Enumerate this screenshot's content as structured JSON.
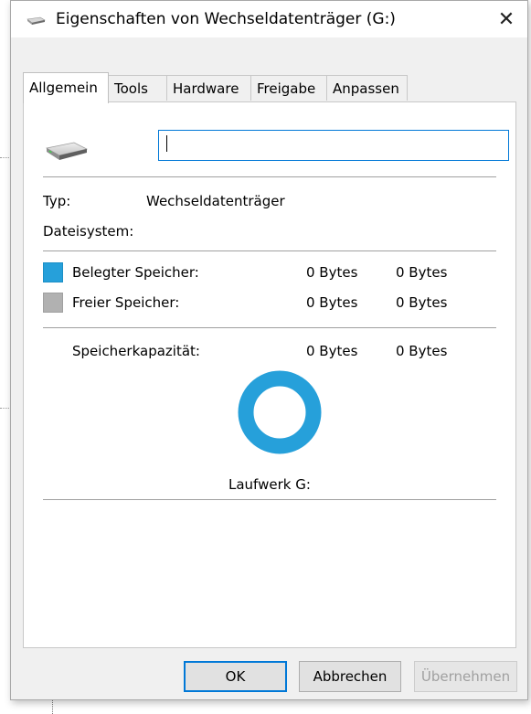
{
  "window": {
    "title": "Eigenschaften von Wechseldatenträger (G:)",
    "close_glyph": "✕",
    "icon": "removable-drive-icon"
  },
  "tabs": [
    {
      "label": "Allgemein",
      "active": true
    },
    {
      "label": "Tools",
      "active": false
    },
    {
      "label": "Hardware",
      "active": false
    },
    {
      "label": "Freigabe",
      "active": false
    },
    {
      "label": "Anpassen",
      "active": false
    }
  ],
  "general": {
    "drive_name_value": "",
    "type_label": "Typ:",
    "type_value": "Wechseldatenträger",
    "filesystem_label": "Dateisystem:",
    "filesystem_value": "",
    "used": {
      "label": "Belegter Speicher:",
      "bytes": "0 Bytes",
      "size": "0 Bytes",
      "color": "#26a0da"
    },
    "free": {
      "label": "Freier Speicher:",
      "bytes": "0 Bytes",
      "size": "0 Bytes",
      "color": "#b1b1b1"
    },
    "capacity": {
      "label": "Speicherkapazität:",
      "bytes": "0 Bytes",
      "size": "0 Bytes"
    },
    "drive_label": "Laufwerk G:",
    "used_fraction": 0
  },
  "buttons": {
    "ok": "OK",
    "cancel": "Abbrechen",
    "apply": "Übernehmen"
  }
}
